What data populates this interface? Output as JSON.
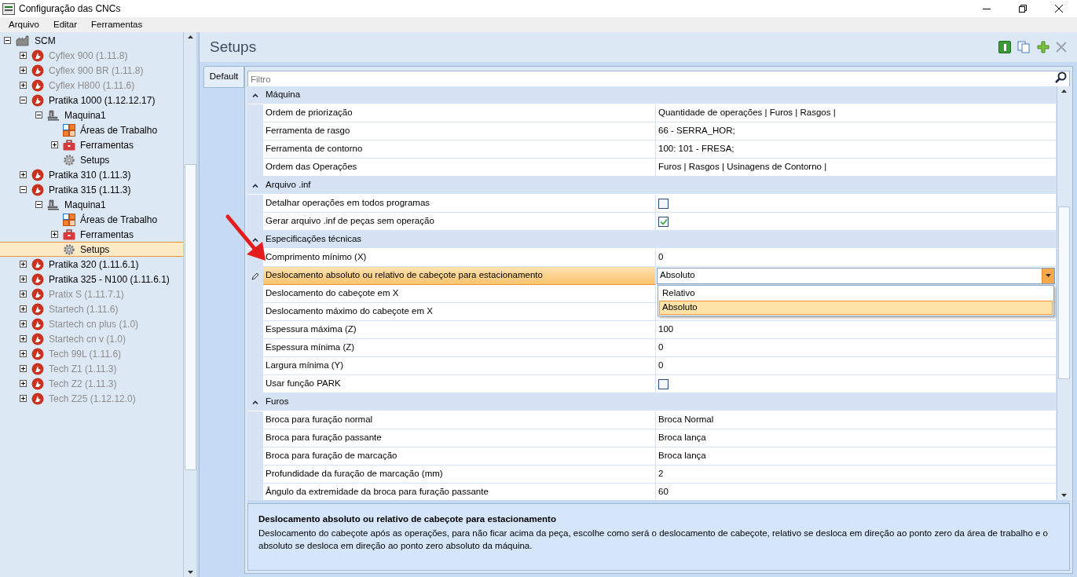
{
  "window": {
    "title": "Configuração das CNCs"
  },
  "menu": [
    "Arquivo",
    "Editar",
    "Ferramentas"
  ],
  "tree": [
    {
      "label": "SCM",
      "kind": "factory",
      "disabled": false,
      "selected": false,
      "expanded": true,
      "children": [
        {
          "label": "Cyflex 900 (1.11.8)",
          "kind": "cnc",
          "disabled": true,
          "selected": false,
          "expanded": false
        },
        {
          "label": "Cyflex 900 BR (1.11.8)",
          "kind": "cnc",
          "disabled": true,
          "selected": false,
          "expanded": false
        },
        {
          "label": "Cyflex H800 (1.11.6)",
          "kind": "cnc",
          "disabled": true,
          "selected": false,
          "expanded": false
        },
        {
          "label": "Pratika 1000 (1.12.12.17)",
          "kind": "cnc",
          "disabled": false,
          "selected": false,
          "expanded": true,
          "children": [
            {
              "label": "Maquina1",
              "kind": "machine",
              "disabled": false,
              "selected": false,
              "expanded": true,
              "children": [
                {
                  "label": "Áreas de Trabalho",
                  "kind": "areas",
                  "disabled": false,
                  "selected": false
                },
                {
                  "label": "Ferramentas",
                  "kind": "toolbox",
                  "disabled": false,
                  "selected": false,
                  "expanded": false
                },
                {
                  "label": "Setups",
                  "kind": "gear",
                  "disabled": false,
                  "selected": false
                }
              ]
            }
          ]
        },
        {
          "label": "Pratika 310 (1.11.3)",
          "kind": "cnc",
          "disabled": false,
          "selected": false,
          "expanded": false
        },
        {
          "label": "Pratika 315 (1.11.3)",
          "kind": "cnc",
          "disabled": false,
          "selected": false,
          "expanded": true,
          "children": [
            {
              "label": "Maquina1",
              "kind": "machine",
              "disabled": false,
              "selected": false,
              "expanded": true,
              "children": [
                {
                  "label": "Áreas de Trabalho",
                  "kind": "areas",
                  "disabled": false,
                  "selected": false
                },
                {
                  "label": "Ferramentas",
                  "kind": "toolbox",
                  "disabled": false,
                  "selected": false,
                  "expanded": false
                },
                {
                  "label": "Setups",
                  "kind": "gear",
                  "disabled": false,
                  "selected": true
                }
              ]
            }
          ]
        },
        {
          "label": "Pratika 320 (1.11.6.1)",
          "kind": "cnc",
          "disabled": false,
          "selected": false,
          "expanded": false
        },
        {
          "label": "Pratika 325 - N100 (1.11.6.1)",
          "kind": "cnc",
          "disabled": false,
          "selected": false,
          "expanded": false
        },
        {
          "label": "Pratix S (1.11.7.1)",
          "kind": "cnc",
          "disabled": true,
          "selected": false,
          "expanded": false
        },
        {
          "label": "Startech (1.11.6)",
          "kind": "cnc",
          "disabled": true,
          "selected": false,
          "expanded": false
        },
        {
          "label": "Startech cn plus (1.0)",
          "kind": "cnc",
          "disabled": true,
          "selected": false,
          "expanded": false
        },
        {
          "label": "Startech cn v (1.0)",
          "kind": "cnc",
          "disabled": true,
          "selected": false,
          "expanded": false
        },
        {
          "label": "Tech 99L (1.11.6)",
          "kind": "cnc",
          "disabled": true,
          "selected": false,
          "expanded": false
        },
        {
          "label": "Tech Z1 (1.11.3)",
          "kind": "cnc",
          "disabled": true,
          "selected": false,
          "expanded": false
        },
        {
          "label": "Tech Z2 (1.11.3)",
          "kind": "cnc",
          "disabled": true,
          "selected": false,
          "expanded": false
        },
        {
          "label": "Tech Z25 (1.12.12.0)",
          "kind": "cnc",
          "disabled": true,
          "selected": false,
          "expanded": false
        }
      ]
    }
  ],
  "panel": {
    "title": "Setups",
    "tabs": [
      {
        "label": "Default",
        "selected": true
      }
    ],
    "filter": {
      "placeholder": "Filtro"
    }
  },
  "sections": [
    {
      "title": "Máquina",
      "expanded": true,
      "rows": [
        {
          "label": "Ordem de priorização",
          "kind": "text",
          "value": "Quantidade de operações | Furos | Rasgos |",
          "selected": false
        },
        {
          "label": "Ferramenta de rasgo",
          "kind": "text",
          "value": "66 - SERRA_HOR;",
          "selected": false
        },
        {
          "label": "Ferramenta de contorno",
          "kind": "text",
          "value": "100: 101 - FRESA;",
          "selected": false
        },
        {
          "label": "Ordem das Operações",
          "kind": "text",
          "value": "Furos | Rasgos | Usinagens de Contorno |",
          "selected": false
        }
      ]
    },
    {
      "title": "Arquivo .inf",
      "expanded": true,
      "rows": [
        {
          "label": "Detalhar operações em todos programas",
          "kind": "check",
          "checked": false,
          "selected": false
        },
        {
          "label": "Gerar arquivo .inf de peças sem operação",
          "kind": "check",
          "checked": true,
          "selected": false
        }
      ]
    },
    {
      "title": "Especificações técnicas",
      "expanded": true,
      "rows": [
        {
          "label": "Comprimento mínimo (X)",
          "kind": "text",
          "value": "0",
          "selected": false
        },
        {
          "label": "Deslocamento absoluto ou relativo de cabeçote para estacionamento",
          "kind": "combo",
          "value": "Absoluto",
          "selected": true,
          "options": [
            {
              "label": "Relativo",
              "selected": false
            },
            {
              "label": "Absoluto",
              "selected": true
            }
          ]
        },
        {
          "label": "Deslocamento do cabeçote em X",
          "kind": "text",
          "selected": false
        },
        {
          "label": "Deslocamento máximo do cabeçote em X",
          "kind": "text",
          "selected": false
        },
        {
          "label": "Espessura máxima (Z)",
          "kind": "text",
          "value": "100",
          "selected": false
        },
        {
          "label": "Espessura mínima (Z)",
          "kind": "text",
          "value": "0",
          "selected": false
        },
        {
          "label": "Largura mínima (Y)",
          "kind": "text",
          "value": "0",
          "selected": false
        },
        {
          "label": "Usar função PARK",
          "kind": "check",
          "checked": false,
          "selected": false
        }
      ]
    },
    {
      "title": "Furos",
      "expanded": true,
      "rows": [
        {
          "label": "Broca para furação normal",
          "kind": "text",
          "value": "Broca Normal",
          "selected": false
        },
        {
          "label": "Broca para furação passante",
          "kind": "text",
          "value": "Broca lança",
          "selected": false
        },
        {
          "label": "Broca para furação de marcação",
          "kind": "text",
          "value": "Broca lança",
          "selected": false
        },
        {
          "label": "Profundidade da furação de marcação (mm)",
          "kind": "text",
          "value": "2",
          "selected": false
        },
        {
          "label": "Ângulo da extremidade da broca para furação passante",
          "kind": "text",
          "value": "60",
          "selected": false
        }
      ]
    }
  ],
  "description": {
    "title": "Deslocamento absoluto ou relativo de cabeçote para estacionamento",
    "text": "Deslocamento do cabeçote após as operações, para não ficar acima da peça, escolhe como será o deslocamento de cabeçote, relativo se desloca em direção ao ponto zero da área de trabalho e o absoluto se desloca em direção ao ponto zero absoluto da máquina."
  }
}
